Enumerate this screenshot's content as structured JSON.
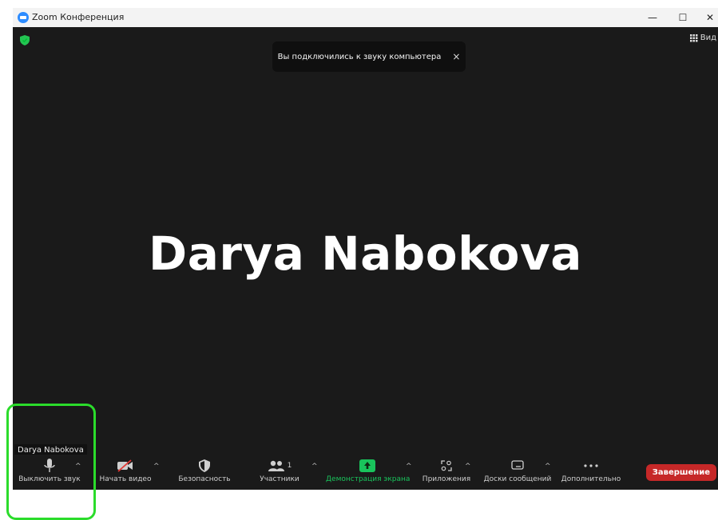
{
  "window": {
    "title": "Zoom Конференция",
    "controls": {
      "minimize": "—",
      "maximize": "☐",
      "close": "✕"
    }
  },
  "meeting": {
    "view_label": "Вид",
    "toast_text": "Вы подключились к звуку компьютера",
    "toast_close": "×",
    "participant_name": "Darya Nabokova",
    "name_tag": "Darya Nabokova"
  },
  "toolbar": {
    "mute_label": "Выключить звук",
    "video_label": "Начать видео",
    "security_label": "Безопасность",
    "participants_label": "Участники",
    "participants_count": "1",
    "share_label": "Демонстрация экрана",
    "apps_label": "Приложения",
    "whiteboards_label": "Доски сообщений",
    "more_label": "Дополнительно",
    "end_label": "Завершение",
    "caret": "^"
  },
  "colors": {
    "stage_bg": "#1a1a1a",
    "share_green": "#19c45c",
    "end_red": "#c62828",
    "highlight_green": "#2bdc2b",
    "zoom_blue": "#2d8cff"
  }
}
